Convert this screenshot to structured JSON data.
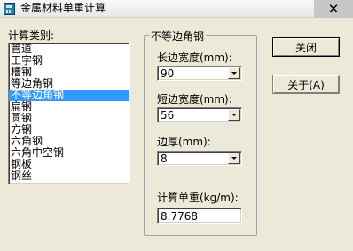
{
  "window": {
    "title": "金属材料单重计算",
    "close_glyph": "✕"
  },
  "category": {
    "label": "计算类别:",
    "items": [
      "管道",
      "工字钢",
      "槽钢",
      "等边角钢",
      "不等边角钢",
      "扁钢",
      "圆钢",
      "方钢",
      "六角钢",
      "六角中空钢",
      "钢板",
      "钢丝"
    ],
    "selected_index": 4
  },
  "group": {
    "title": "不等边角钢",
    "long_side": {
      "label": "长边宽度(mm):",
      "value": "90"
    },
    "short_side": {
      "label": "短边宽度(mm):",
      "value": "56"
    },
    "thickness": {
      "label": "边厚(mm):",
      "value": "8"
    },
    "result": {
      "label": "计算单重(kg/m):",
      "value": "8.7768"
    }
  },
  "buttons": {
    "close_label": "关闭",
    "about_label": "关于(A)"
  },
  "colors": {
    "selection": "#3399ff",
    "dialog_bg": "#ece9d8"
  },
  "icons": {
    "app": "app-icon",
    "dropdown": "chevron-down-icon"
  }
}
